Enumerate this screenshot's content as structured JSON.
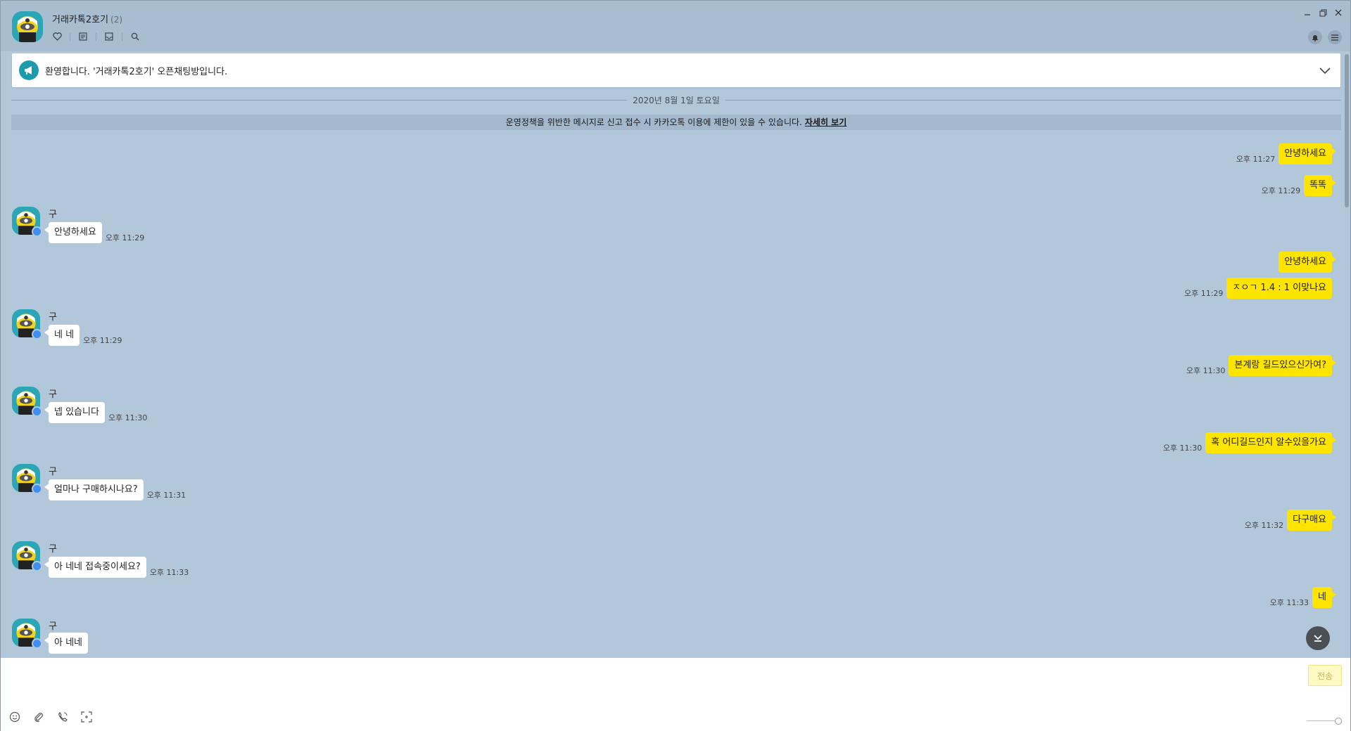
{
  "header": {
    "room_title": "거래카톡2호기",
    "member_count": "(2)"
  },
  "notice": {
    "text": "환영합니다. '거래카톡2호기' 오픈채팅방입니다."
  },
  "date_divider": "2020년 8월 1일 토요일",
  "policy": {
    "text": "운영정책을 위반한 메시지로 신고 접수 시 카카오톡 이용에 제한이 있을 수 있습니다.",
    "link": "자세히 보기"
  },
  "messages": [
    {
      "from": "me",
      "text": "안녕하세요",
      "time": "오후 11:27"
    },
    {
      "from": "me",
      "text": "똑똑",
      "time": "오후 11:29"
    },
    {
      "from": "other",
      "name": "구",
      "text": "안녕하세요",
      "time": "오후 11:29"
    },
    {
      "from": "me",
      "text": "안녕하세요",
      "time": ""
    },
    {
      "from": "me",
      "text": "ㅈㅇㄱ 1.4 : 1 이맞나요",
      "time": "오후 11:29"
    },
    {
      "from": "other",
      "name": "구",
      "text": "네 네",
      "time": "오후 11:29"
    },
    {
      "from": "me",
      "text": "본계랑 길드있으신가여?",
      "time": "오후 11:30"
    },
    {
      "from": "other",
      "name": "구",
      "text": "넵 있습니다",
      "time": "오후 11:30"
    },
    {
      "from": "me",
      "text": "혹 어디길드인지 알수있을가요",
      "time": "오후 11:30"
    },
    {
      "from": "other",
      "name": "구",
      "text": "얼마나 구매하시나요?",
      "time": "오후 11:31"
    },
    {
      "from": "me",
      "text": "다구매요",
      "time": "오후 11:32"
    },
    {
      "from": "other",
      "name": "구",
      "text": "아 네네 접속중이세요?",
      "time": "오후 11:33"
    },
    {
      "from": "me",
      "text": "네",
      "time": "오후 11:33"
    },
    {
      "from": "other",
      "name": "구",
      "text": "아 네네",
      "time": ""
    }
  ],
  "input": {
    "placeholder": "",
    "send_label": "전송"
  }
}
